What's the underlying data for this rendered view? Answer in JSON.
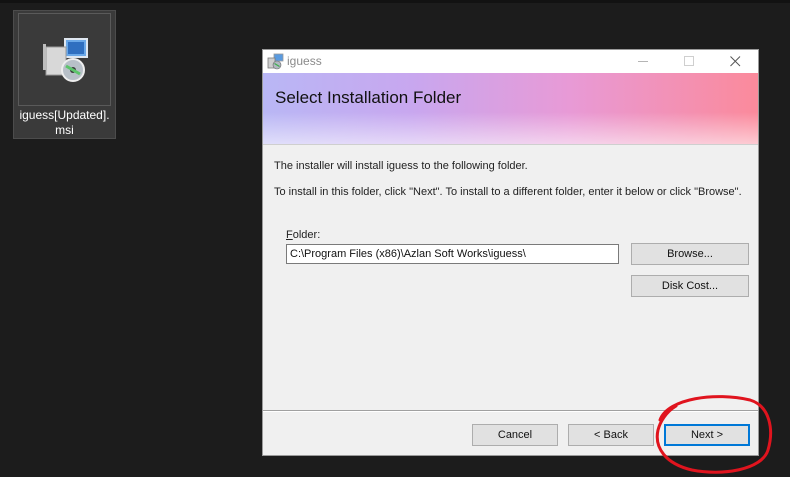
{
  "desktop": {
    "file_icon_name": "msi-installer-icon",
    "file_label_line1": "iguess[Updated].",
    "file_label_line2": "msi"
  },
  "window": {
    "title": "iguess",
    "app_icon_name": "installer-icon",
    "controls": [
      "minimize-icon",
      "maximize-icon",
      "close-icon"
    ]
  },
  "banner": {
    "heading": "Select Installation Folder"
  },
  "body": {
    "line1": "The installer will install iguess to the following folder.",
    "line2": "To install in this folder, click \"Next\". To install to a different folder, enter it below or click \"Browse\".",
    "folder_label": "Folder:",
    "folder_value": "C:\\Program Files (x86)\\Azlan Soft Works\\iguess\\",
    "browse_label": "Browse...",
    "disk_cost_label": "Disk Cost..."
  },
  "footer": {
    "cancel_label": "Cancel",
    "back_label": "< Back",
    "next_label": "Next >"
  },
  "colors": {
    "desktop_bg": "#1c1c1c",
    "focus_border": "#0078d7",
    "annotation": "#e0141e"
  }
}
